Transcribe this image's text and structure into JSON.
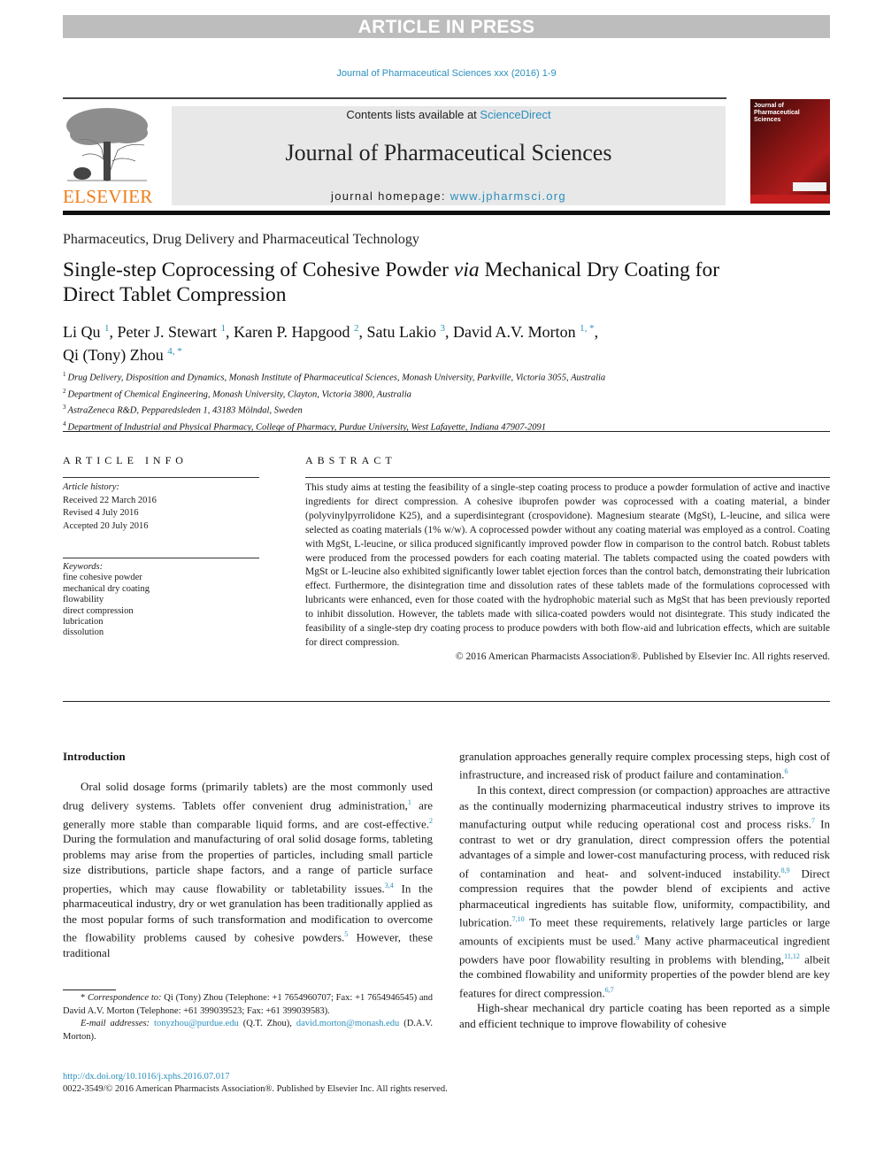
{
  "banner": {
    "text": "ARTICLE IN PRESS"
  },
  "citation": "Journal of Pharmaceutical Sciences xxx (2016) 1-9",
  "header": {
    "publisher_logo_text": "ELSEVIER",
    "contents_prefix": "Contents lists available at ",
    "contents_link": "ScienceDirect",
    "journal_title": "Journal of Pharmaceutical Sciences",
    "homepage_prefix": "journal homepage: ",
    "homepage_link": "www.jpharmsci.org",
    "cover_title_lines": [
      "Journal of",
      "Pharmaceutical",
      "Sciences"
    ]
  },
  "colors": {
    "link": "#2a8fbd",
    "elsevier_orange": "#f07d1a",
    "banner_gray": "#bdbdbd",
    "header_gray": "#e8e8e8"
  },
  "article": {
    "section": "Pharmaceutics, Drug Delivery and Pharmaceutical Technology",
    "title_part1": "Single-step Coprocessing of Cohesive Powder ",
    "title_italic": "via",
    "title_part2": " Mechanical Dry Coating for Direct Tablet Compression",
    "authors": [
      {
        "name": "Li Qu",
        "sup": "1"
      },
      {
        "name": "Peter J. Stewart",
        "sup": "1"
      },
      {
        "name": "Karen P. Hapgood",
        "sup": "2"
      },
      {
        "name": "Satu Lakio",
        "sup": "3"
      },
      {
        "name": "David A.V. Morton",
        "sup": "1, *"
      },
      {
        "name": "Qi (Tony) Zhou",
        "sup": "4, *"
      }
    ],
    "affiliations": [
      {
        "num": "1",
        "text": "Drug Delivery, Disposition and Dynamics, Monash Institute of Pharmaceutical Sciences, Monash University, Parkville, Victoria 3055, Australia"
      },
      {
        "num": "2",
        "text": "Department of Chemical Engineering, Monash University, Clayton, Victoria 3800, Australia"
      },
      {
        "num": "3",
        "text": "AstraZeneca R&D, Pepparedsleden 1, 43183 Mölndal, Sweden"
      },
      {
        "num": "4",
        "text": "Department of Industrial and Physical Pharmacy, College of Pharmacy, Purdue University, West Lafayette, Indiana 47907-2091"
      }
    ]
  },
  "article_info": {
    "heading": "ARTICLE INFO",
    "history_label": "Article history:",
    "history": [
      "Received 22 March 2016",
      "Revised 4 July 2016",
      "Accepted 20 July 2016"
    ],
    "keywords_label": "Keywords:",
    "keywords": [
      "fine cohesive powder",
      "mechanical dry coating",
      "flowability",
      "direct compression",
      "lubrication",
      "dissolution"
    ]
  },
  "abstract": {
    "heading": "ABSTRACT",
    "text": "This study aims at testing the feasibility of a single-step coating process to produce a powder formulation of active and inactive ingredients for direct compression. A cohesive ibuprofen powder was coprocessed with a coating material, a binder (polyvinylpyrrolidone K25), and a superdisintegrant (crospovidone). Magnesium stearate (MgSt), L-leucine, and silica were selected as coating materials (1% w/w). A coprocessed powder without any coating material was employed as a control. Coating with MgSt, L-leucine, or silica produced significantly improved powder flow in comparison to the control batch. Robust tablets were produced from the processed powders for each coating material. The tablets compacted using the coated powders with MgSt or L-leucine also exhibited significantly lower tablet ejection forces than the control batch, demonstrating their lubrication effect. Furthermore, the disintegration time and dissolution rates of these tablets made of the formulations coprocessed with lubricants were enhanced, even for those coated with the hydrophobic material such as MgSt that has been previously reported to inhibit dissolution. However, the tablets made with silica-coated powders would not disintegrate. This study indicated the feasibility of a single-step dry coating process to produce powders with both flow-aid and lubrication effects, which are suitable for direct compression.",
    "copyright": "© 2016 American Pharmacists Association®. Published by Elsevier Inc. All rights reserved."
  },
  "body": {
    "intro_heading": "Introduction",
    "left_para": [
      {
        "t": "Oral solid dosage forms (primarily tablets) are the most commonly used drug delivery systems. Tablets offer convenient drug administration,"
      },
      {
        "ref": "1"
      },
      {
        "t": " are generally more stable than comparable liquid forms, and are cost-effective."
      },
      {
        "ref": "2"
      },
      {
        "t": " During the formulation and manufacturing of oral solid dosage forms, tableting problems may arise from the properties of particles, including small particle size distributions, particle shape factors, and a range of particle surface properties, which may cause flowability or tabletability issues."
      },
      {
        "ref": "3,4"
      },
      {
        "t": " In the pharmaceutical industry, dry or wet granulation has been traditionally applied as the most popular forms of such transformation and modification to overcome the flowability problems caused by cohesive powders."
      },
      {
        "ref": "5"
      },
      {
        "t": " However, these traditional"
      }
    ],
    "right_para1": [
      {
        "t": "granulation approaches generally require complex processing steps, high cost of infrastructure, and increased risk of product failure and contamination."
      },
      {
        "ref": "6"
      }
    ],
    "right_para2": [
      {
        "t": "In this context, direct compression (or compaction) approaches are attractive as the continually modernizing pharmaceutical industry strives to improve its manufacturing output while reducing operational cost and process risks."
      },
      {
        "ref": "7"
      },
      {
        "t": " In contrast to wet or dry granulation, direct compression offers the potential advantages of a simple and lower-cost manufacturing process, with reduced risk of contamination and heat- and solvent-induced instability."
      },
      {
        "ref": "8,9"
      },
      {
        "t": " Direct compression requires that the powder blend of excipients and active pharmaceutical ingredients has suitable flow, uniformity, compactibility, and lubrication."
      },
      {
        "ref": "7,10"
      },
      {
        "t": " To meet these requirements, relatively large particles or large amounts of excipients must be used."
      },
      {
        "ref": "9"
      },
      {
        "t": " Many active pharmaceutical ingredient powders have poor flowability resulting in problems with blending,"
      },
      {
        "ref": "11,12"
      },
      {
        "t": " albeit the combined flowability and uniformity properties of the powder blend are key features for direct compression."
      },
      {
        "ref": "6,7"
      }
    ],
    "right_para3": [
      {
        "t": "High-shear mechanical dry particle coating has been reported as a simple and efficient technique to improve flowability of cohesive"
      }
    ]
  },
  "footnote": {
    "corr_label": "Correspondence to:",
    "corr_text": " Qi (Tony) Zhou (Telephone: +1 7654960707; Fax: +1 7654946545) and David A.V. Morton (Telephone: +61 399039523; Fax: +61 399039583).",
    "email_label": "E-mail addresses:",
    "email1": "tonyzhou@purdue.edu",
    "email1_owner": " (Q.T. Zhou), ",
    "email2": "david.morton@monash.edu",
    "email2_owner": " (D.A.V. Morton)."
  },
  "footer": {
    "doi": "http://dx.doi.org/10.1016/j.xphs.2016.07.017",
    "issn_line": "0022-3549/© 2016 American Pharmacists Association®. Published by Elsevier Inc. All rights reserved."
  }
}
